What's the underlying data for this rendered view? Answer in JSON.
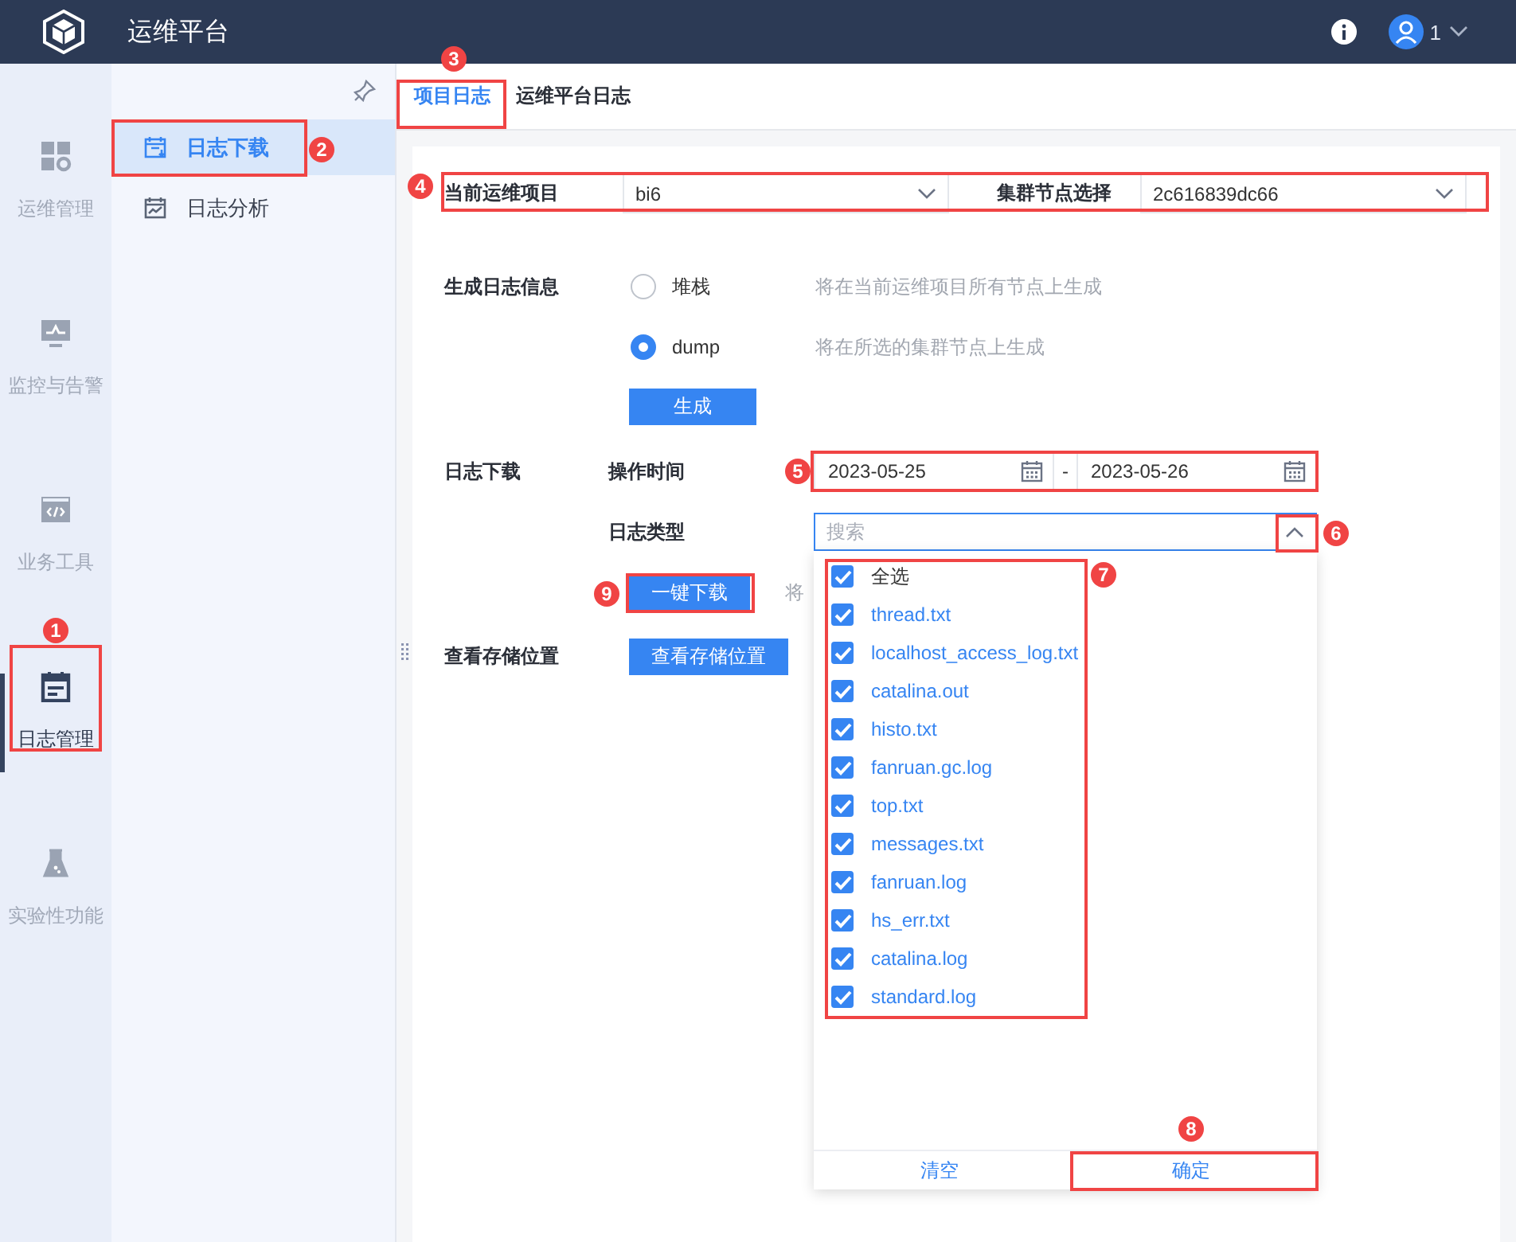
{
  "header": {
    "title": "运维平台",
    "user": "1"
  },
  "rail": [
    {
      "label": "运维管理",
      "selected": false
    },
    {
      "label": "监控与告警",
      "selected": false
    },
    {
      "label": "业务工具",
      "selected": false
    },
    {
      "label": "日志管理",
      "selected": true
    },
    {
      "label": "实验性功能",
      "selected": false
    }
  ],
  "submenu": [
    {
      "label": "日志下载",
      "selected": true
    },
    {
      "label": "日志分析",
      "selected": false
    }
  ],
  "tabs": [
    {
      "label": "项目日志",
      "selected": true
    },
    {
      "label": "运维平台日志",
      "selected": false
    }
  ],
  "project_select": {
    "label": "当前运维项目",
    "value": "bi6"
  },
  "node_select": {
    "label": "集群节点选择",
    "value": "2c616839dc66"
  },
  "generate": {
    "label": "生成日志信息",
    "options": [
      {
        "label": "堆栈",
        "hint": "将在当前运维项目所有节点上生成",
        "selected": false
      },
      {
        "label": "dump",
        "hint": "将在所选的集群节点上生成",
        "selected": true
      }
    ],
    "button": "生成"
  },
  "download": {
    "label": "日志下载",
    "time_label": "操作时间",
    "start": "2023-05-25",
    "separator": "-",
    "end": "2023-05-26",
    "type_label": "日志类型",
    "type_placeholder": "搜索",
    "expanded": true,
    "button": "一键下载",
    "note": "将"
  },
  "storage": {
    "label": "查看存储位置",
    "button": "查看存储位置"
  },
  "log_types": [
    {
      "kind": "select_all",
      "label": "全选",
      "checked": true
    },
    {
      "kind": "file",
      "label": "thread.txt",
      "checked": true
    },
    {
      "kind": "file",
      "label": "localhost_access_log.txt",
      "checked": true
    },
    {
      "kind": "file",
      "label": "catalina.out",
      "checked": true
    },
    {
      "kind": "file",
      "label": "histo.txt",
      "checked": true
    },
    {
      "kind": "file",
      "label": "fanruan.gc.log",
      "checked": true
    },
    {
      "kind": "file",
      "label": "top.txt",
      "checked": true
    },
    {
      "kind": "file",
      "label": "messages.txt",
      "checked": true
    },
    {
      "kind": "file",
      "label": "fanruan.log",
      "checked": true
    },
    {
      "kind": "file",
      "label": "hs_err.txt",
      "checked": true
    },
    {
      "kind": "file",
      "label": "catalina.log",
      "checked": true
    },
    {
      "kind": "file",
      "label": "standard.log",
      "checked": true
    }
  ],
  "dropdown_footer": {
    "clear": "清空",
    "confirm": "确定"
  },
  "annotations": [
    {
      "number": "1"
    },
    {
      "number": "2"
    },
    {
      "number": "3"
    },
    {
      "number": "4"
    },
    {
      "number": "5"
    },
    {
      "number": "6"
    },
    {
      "number": "7"
    },
    {
      "number": "8"
    },
    {
      "number": "9"
    }
  ]
}
